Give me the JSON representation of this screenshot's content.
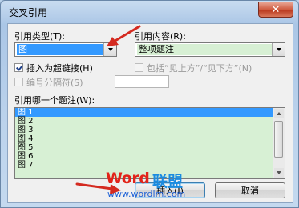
{
  "window": {
    "title": "交叉引用",
    "close_glyph": "✕"
  },
  "ref_type": {
    "label": "引用类型(T):",
    "value": "图"
  },
  "ref_content": {
    "label": "引用内容(R):",
    "value": "整项题注"
  },
  "insert_hyperlink": {
    "label": "插入为超链接(H)",
    "checked": true
  },
  "include_above_below": {
    "label": "包括“见上方”/“见下方”(N)",
    "checked": false
  },
  "number_separator": {
    "label": "编号分隔符(S)",
    "checked": false,
    "value": ""
  },
  "caption_list": {
    "label": "引用哪一个题注(W):",
    "items": [
      "图 1",
      "图 2",
      "图 3",
      "图 4",
      "图 5",
      "图 6",
      "图 7"
    ],
    "selected_index": 0
  },
  "buttons": {
    "insert": "插入(I)",
    "cancel": "取消"
  },
  "watermark": {
    "brand": "Word",
    "brand_cn": "联盟",
    "url": "www.wordlm.com"
  },
  "colors": {
    "list_bg": "#d7f0d4",
    "selection": "#3399ff",
    "arrow": "#d42a20"
  },
  "icons": {
    "close": "close-icon",
    "dropdown": "chevron-down-icon",
    "annotation": "red-arrow-icon"
  }
}
